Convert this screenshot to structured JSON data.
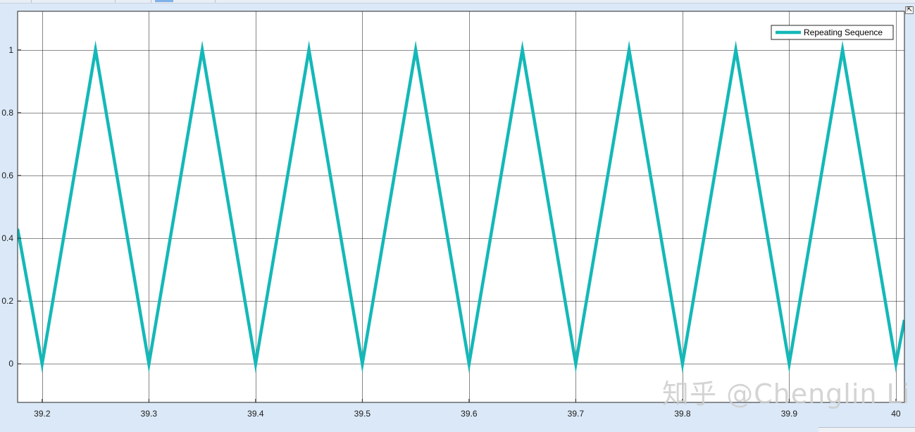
{
  "window": {
    "dock_icon": "dock-arrow-icon"
  },
  "watermark": {
    "text": "知乎 @Chenglin Li"
  },
  "colors": {
    "series": "#14b8b8",
    "background": "#dbe8f7",
    "axes_bg": "#ffffff",
    "grid": "#262626"
  },
  "chart_data": {
    "type": "line",
    "title": "",
    "xlabel": "",
    "ylabel": "",
    "xlim": [
      39.177,
      40.008
    ],
    "ylim": [
      -0.123,
      1.123
    ],
    "xticks": [
      39.2,
      39.3,
      39.4,
      39.5,
      39.6,
      39.7,
      39.8,
      39.9,
      40
    ],
    "xtick_labels": [
      "39.2",
      "39.3",
      "39.4",
      "39.5",
      "39.6",
      "39.7",
      "39.8",
      "39.9",
      "40"
    ],
    "yticks": [
      0,
      0.2,
      0.4,
      0.6,
      0.8,
      1
    ],
    "ytick_labels": [
      "0",
      "0.2",
      "0.4",
      "0.6",
      "0.8",
      "1"
    ],
    "grid": true,
    "legend": {
      "position": "top-right",
      "entries": [
        "Repeating Sequence"
      ]
    },
    "series": [
      {
        "name": "Repeating Sequence",
        "color": "#14b8b8",
        "x": [
          39.177,
          39.2,
          39.25,
          39.3,
          39.35,
          39.4,
          39.45,
          39.5,
          39.55,
          39.6,
          39.65,
          39.7,
          39.75,
          39.8,
          39.85,
          39.9,
          39.95,
          40.0,
          40.008
        ],
        "y": [
          0.43,
          0,
          1,
          0,
          1,
          0,
          1,
          0,
          1,
          0,
          1,
          0,
          1,
          0,
          1,
          0,
          1,
          0,
          0.14
        ]
      }
    ]
  }
}
